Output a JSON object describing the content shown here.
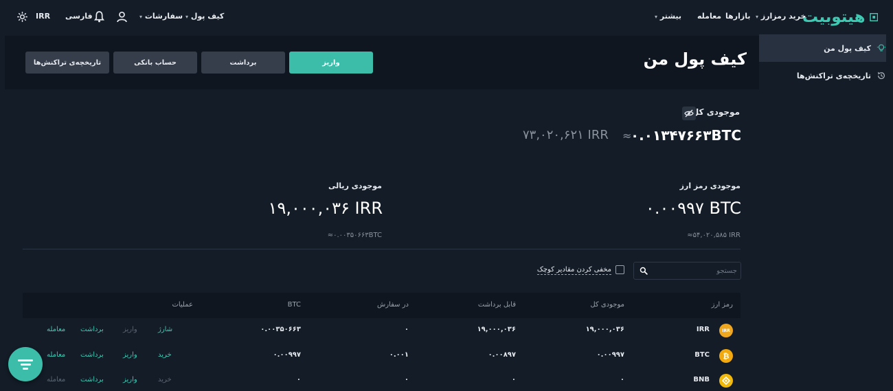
{
  "header": {
    "logo_text": "هیتوبیت",
    "nav": {
      "buy_crypto": "خرید رمزارز",
      "markets": "بازارها",
      "trade": "معامله",
      "more": "بیشتر",
      "wallet": "کیف پول",
      "orders": "سفارشات",
      "language": "فارسی",
      "currency": "IRR"
    }
  },
  "sidebar": {
    "items": [
      {
        "label": "کیف پول من",
        "icon": "bulb-icon",
        "active": true
      },
      {
        "label": "تاریخچه‌ی تراکنش‌ها",
        "icon": "history-icon",
        "active": false
      }
    ]
  },
  "page": {
    "title": "کیف پول من",
    "buttons": {
      "deposit": "واریز",
      "withdraw": "برداشت",
      "bank_account": "حساب بانکی",
      "history": "تاریخچه‌ی تراکنش‌ها"
    }
  },
  "total": {
    "label": "موجودی کل",
    "btc": "۰.۰۱۳۴۷۶۶۳BTC",
    "approx": "≈",
    "irr": "۷۳,۰۲۰,۶۲۱ IRR"
  },
  "crypto_balance": {
    "label": "موجودی رمز ارز",
    "value": "۰.۰۰۹۹۷ BTC",
    "sub": "≈۵۴,۰۲۰,۵۸۵ IRR"
  },
  "rial_balance": {
    "label": "موجودی ریالی",
    "value": "۱۹,۰۰۰,۰۳۶ IRR",
    "sub": "≈۰.۰۰۳۵۰۶۶۳BTC"
  },
  "filters": {
    "search_placeholder": "جستجو",
    "hide_small": "مخفی کردن مقادیر کوچک"
  },
  "table": {
    "headers": {
      "coin": "رمز ارز",
      "total": "موجودی کل",
      "withdrawable": "قابل برداشت",
      "in_order": "در سفارش",
      "btc": "BTC",
      "operations": "عملیات"
    },
    "rows": [
      {
        "coin": "IRR",
        "icon_color": "#f0a720",
        "total": "۱۹,۰۰۰,۰۳۶",
        "withdrawable": "۱۹,۰۰۰,۰۳۶",
        "in_order": "۰",
        "btc": "۰.۰۰۳۵۰۶۶۳",
        "op1": "شارژ",
        "op2": "واریز",
        "op3": "برداشت",
        "op4": "معامله"
      },
      {
        "coin": "BTC",
        "icon_color": "#f2a90f",
        "total": "۰.۰۰۹۹۷",
        "withdrawable": "۰.۰۰۸۹۷",
        "in_order": "۰.۰۰۱",
        "btc": "۰.۰۰۹۹۷",
        "op1": "خرید",
        "op2": "واریز",
        "op3": "برداشت",
        "op4": "معامله"
      },
      {
        "coin": "BNB",
        "icon_color": "#f0b90b",
        "total": "۰",
        "withdrawable": "۰",
        "in_order": "۰",
        "btc": "۰",
        "op1": "خرید",
        "op2": "واریز",
        "op3": "برداشت",
        "op4": "معامله"
      }
    ]
  }
}
